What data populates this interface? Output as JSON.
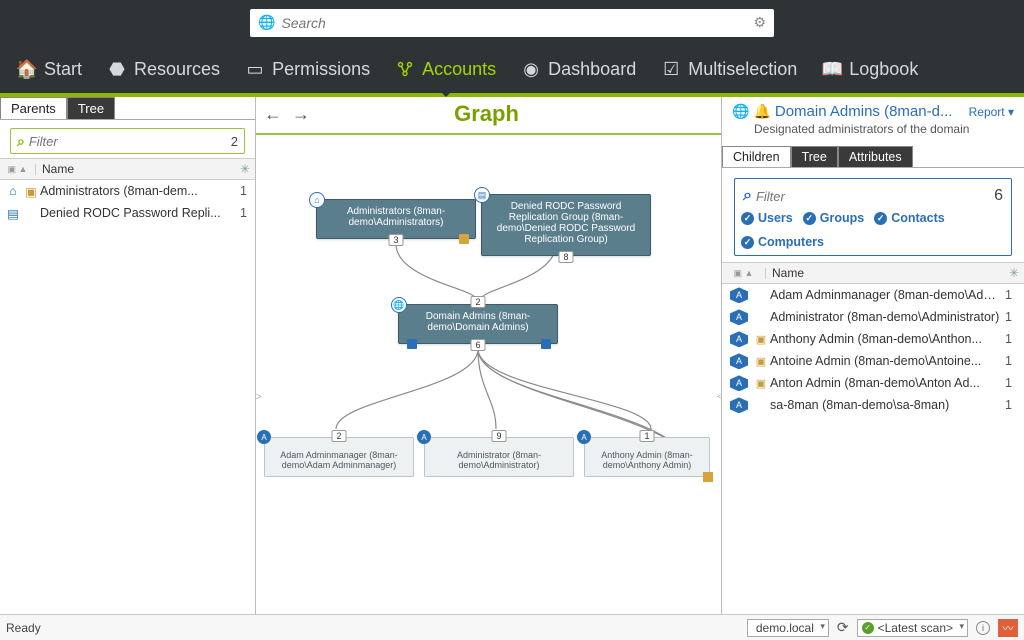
{
  "search": {
    "placeholder": "Search"
  },
  "nav": {
    "items": [
      {
        "label": "Start"
      },
      {
        "label": "Resources"
      },
      {
        "label": "Permissions"
      },
      {
        "label": "Accounts"
      },
      {
        "label": "Dashboard"
      },
      {
        "label": "Multiselection"
      },
      {
        "label": "Logbook"
      }
    ],
    "active_index": 3
  },
  "left": {
    "tabs": [
      "Parents",
      "Tree"
    ],
    "active_tab": 0,
    "filter_placeholder": "Filter",
    "filter_count": "2",
    "col_name": "Name",
    "rows": [
      {
        "label": "Administrators (8man-dem...",
        "count": "1",
        "icon": "home"
      },
      {
        "label": "Denied RODC Password Repli...",
        "count": "1",
        "icon": "group"
      }
    ]
  },
  "center": {
    "title": "Graph",
    "nodes_top": [
      {
        "label": "Administrators (8man-demo\\Administrators)",
        "badge": "3"
      },
      {
        "label": "Denied RODC Password Replication Group (8man-demo\\Denied RODC Password Replication Group)",
        "badge": "8"
      }
    ],
    "node_mid": {
      "label": "Domain Admins (8man-demo\\Domain Admins)",
      "badge_top": "2",
      "badge_bottom": "6"
    },
    "nodes_bottom": [
      {
        "label": "Adam Adminmanager (8man-demo\\Adam Adminmanager)",
        "badge": "2"
      },
      {
        "label": "Administrator (8man-demo\\Administrator)",
        "badge": "9"
      },
      {
        "label": "Anthony Admin (8man-demo\\Anthony Admin)",
        "badge": "1"
      }
    ]
  },
  "right": {
    "title": "Domain Admins (8man-d...",
    "report_label": "Report",
    "description": "Designated administrators of the domain",
    "tabs": [
      "Children",
      "Tree",
      "Attributes"
    ],
    "active_tab": 0,
    "filter_placeholder": "Filter",
    "filter_count": "6",
    "chips": [
      "Users",
      "Groups",
      "Contacts",
      "Computers"
    ],
    "col_name": "Name",
    "rows": [
      {
        "label": "Adam Adminmanager (8man-demo\\Ada...",
        "count": "1",
        "folder": false
      },
      {
        "label": "Administrator (8man-demo\\Administrator)",
        "count": "1",
        "folder": false
      },
      {
        "label": "Anthony Admin (8man-demo\\Anthon...",
        "count": "1",
        "folder": true
      },
      {
        "label": "Antoine Admin (8man-demo\\Antoine...",
        "count": "1",
        "folder": true
      },
      {
        "label": "Anton Admin (8man-demo\\Anton Ad...",
        "count": "1",
        "folder": true
      },
      {
        "label": "sa-8man (8man-demo\\sa-8man)",
        "count": "1",
        "folder": false
      }
    ]
  },
  "status": {
    "ready": "Ready",
    "domain": "demo.local",
    "scan": "<Latest scan>"
  }
}
